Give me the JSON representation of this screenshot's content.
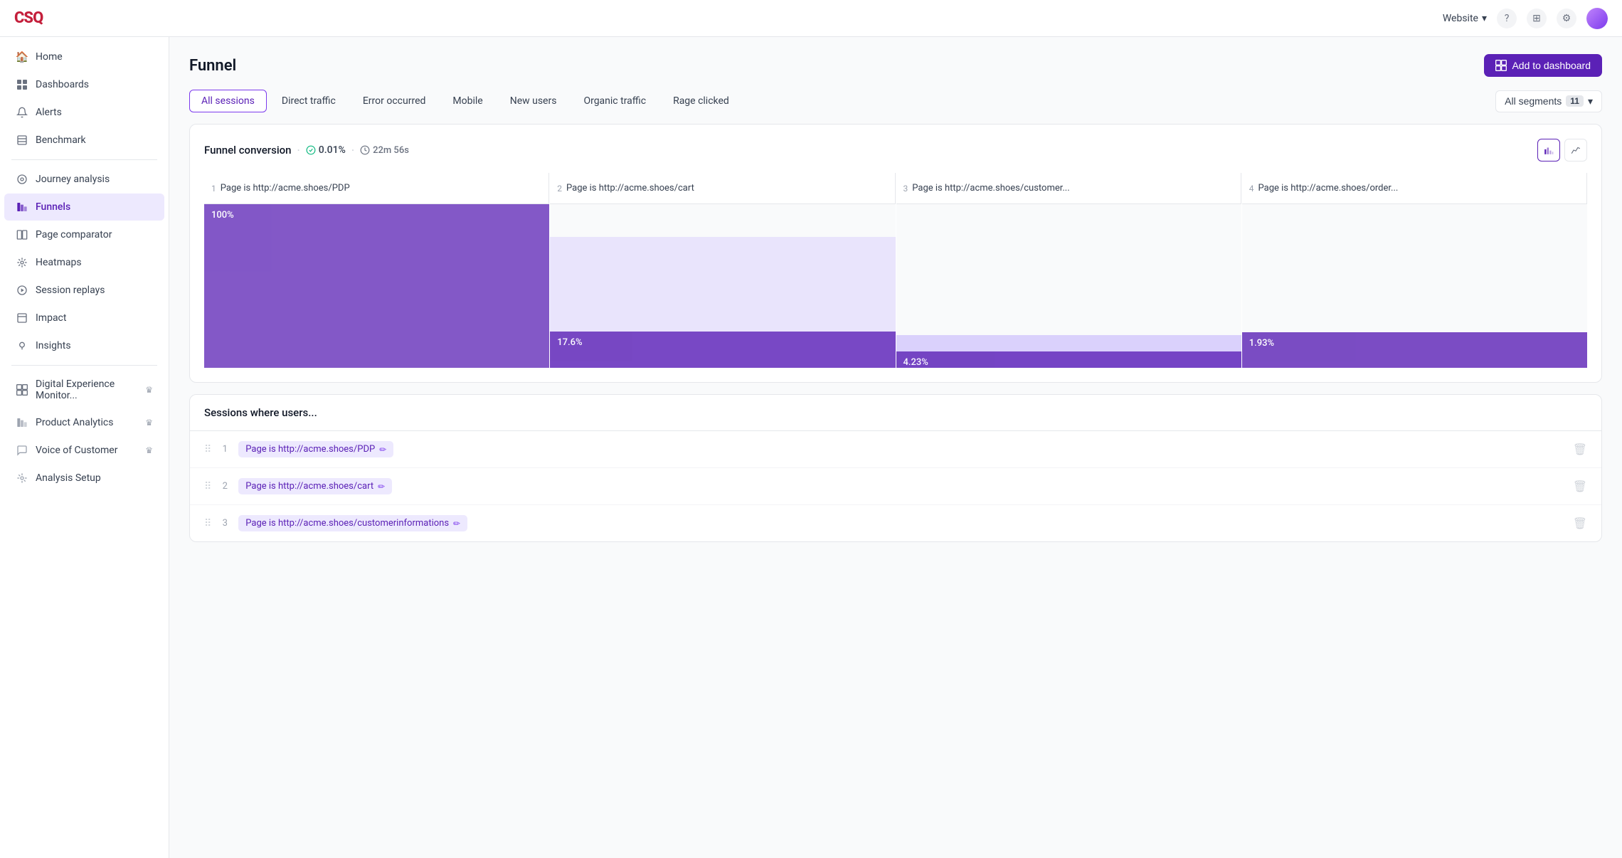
{
  "topbar": {
    "logo": "CSQ",
    "website_label": "Website",
    "chevron": "▾",
    "help_icon": "?",
    "grid_icon": "⊞",
    "settings_icon": "⚙"
  },
  "sidebar": {
    "items": [
      {
        "id": "home",
        "label": "Home",
        "icon": "🏠"
      },
      {
        "id": "dashboards",
        "label": "Dashboards",
        "icon": "▦"
      },
      {
        "id": "alerts",
        "label": "Alerts",
        "icon": "🔔"
      },
      {
        "id": "benchmark",
        "label": "Benchmark",
        "icon": "▤"
      },
      {
        "id": "journey-analysis",
        "label": "Journey analysis",
        "icon": "◎"
      },
      {
        "id": "funnels",
        "label": "Funnels",
        "icon": "▌▌",
        "active": true
      },
      {
        "id": "page-comparator",
        "label": "Page comparator",
        "icon": "⧉"
      },
      {
        "id": "heatmaps",
        "label": "Heatmaps",
        "icon": "✳"
      },
      {
        "id": "session-replays",
        "label": "Session replays",
        "icon": "◎"
      },
      {
        "id": "impact",
        "label": "Impact",
        "icon": "▤"
      },
      {
        "id": "insights",
        "label": "Insights",
        "icon": "💡"
      }
    ],
    "groups": [
      {
        "id": "digital-experience",
        "label": "Digital Experience Monitor...",
        "icon": "▦",
        "crown": true
      },
      {
        "id": "product-analytics",
        "label": "Product Analytics",
        "icon": "▌▌",
        "crown": true
      },
      {
        "id": "voice-of-customer",
        "label": "Voice of Customer",
        "icon": "◎",
        "crown": true
      },
      {
        "id": "analysis-setup",
        "label": "Analysis Setup",
        "icon": "✳"
      }
    ]
  },
  "page": {
    "title": "Funnel",
    "add_dashboard_label": "Add to dashboard"
  },
  "tabs": [
    {
      "id": "all-sessions",
      "label": "All sessions",
      "active": true
    },
    {
      "id": "direct-traffic",
      "label": "Direct traffic"
    },
    {
      "id": "error-occurred",
      "label": "Error occurred"
    },
    {
      "id": "mobile",
      "label": "Mobile"
    },
    {
      "id": "new-users",
      "label": "New users"
    },
    {
      "id": "organic-traffic",
      "label": "Organic traffic"
    },
    {
      "id": "rage-clicked",
      "label": "Rage clicked"
    }
  ],
  "segments": {
    "label": "All segments",
    "count": "11"
  },
  "chart": {
    "title": "Funnel conversion",
    "conversion_rate": "0.01%",
    "time": "22m 56s",
    "steps": [
      {
        "num": 1,
        "label": "Page is http://acme.shoes/PDP",
        "pct": "100%",
        "solid_height": 100,
        "ghost_height": 100
      },
      {
        "num": 2,
        "label": "Page is http://acme.shoes/cart",
        "pct": "17.6%",
        "solid_height": 17.6,
        "ghost_height": 80
      },
      {
        "num": 3,
        "label": "Page is http://acme.shoes/customer...",
        "pct": "4.23%",
        "solid_height": 4.23,
        "ghost_height": 20
      },
      {
        "num": 4,
        "label": "Page is http://acme.shoes/order...",
        "pct": "1.93%",
        "solid_height": 1.93,
        "ghost_height": 10
      }
    ]
  },
  "sessions_section": {
    "header": "Sessions where users...",
    "rows": [
      {
        "num": 1,
        "label": "Page is http://acme.shoes/PDP"
      },
      {
        "num": 2,
        "label": "Page is http://acme.shoes/cart"
      },
      {
        "num": 3,
        "label": "Page is http://acme.shoes/customerinformations"
      }
    ]
  }
}
